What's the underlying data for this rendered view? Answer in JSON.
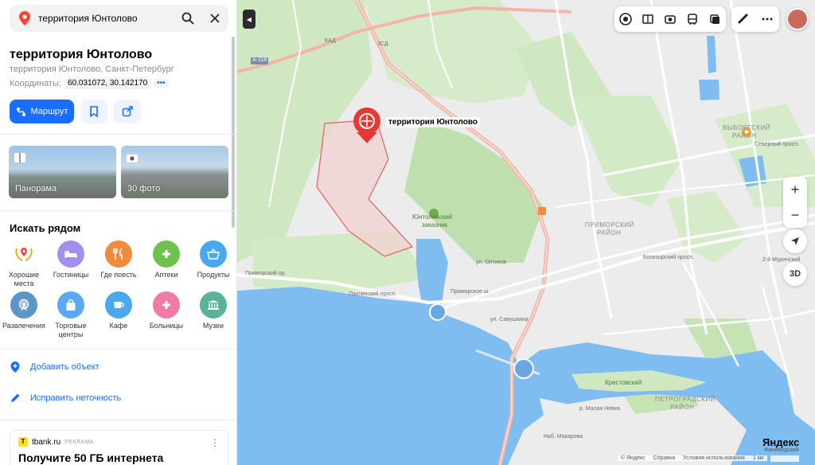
{
  "search": {
    "query": "территория Юнтолово"
  },
  "place": {
    "title": "территория Юнтолово",
    "subtitle": "территория Юнтолово, Санкт-Петербург",
    "coords_label": "Координаты:",
    "coords_value": "60.031072, 30.142170",
    "coords_more": "•••"
  },
  "actions": {
    "route_label": "Маршрут"
  },
  "photos": [
    {
      "label": "Панорама"
    },
    {
      "label": "30 фото"
    }
  ],
  "nearby": {
    "heading": "Искать рядом",
    "categories": [
      {
        "label": "Хорошие места",
        "icon": "laurel-pin-icon",
        "color": "#f5a623"
      },
      {
        "label": "Гостиницы",
        "icon": "bed-icon",
        "color": "#a38ff0"
      },
      {
        "label": "Где поесть",
        "icon": "fork-knife-icon",
        "color": "#f28a3c"
      },
      {
        "label": "Аптеки",
        "icon": "plus-icon",
        "color": "#6cc24a"
      },
      {
        "label": "Продукты",
        "icon": "basket-icon",
        "color": "#4aa8f0"
      },
      {
        "label": "Развлечения",
        "icon": "ferris-wheel-icon",
        "color": "#5b96c9"
      },
      {
        "label": "Торговые центры",
        "icon": "bag-icon",
        "color": "#5aa9f2"
      },
      {
        "label": "Кафе",
        "icon": "cup-icon",
        "color": "#4aa8f0"
      },
      {
        "label": "Больницы",
        "icon": "plus-icon",
        "color": "#f07aa8"
      },
      {
        "label": "Музеи",
        "icon": "museum-icon",
        "color": "#5bb29b"
      }
    ]
  },
  "links": {
    "add_object": "Добавить объект",
    "fix_error": "Исправить неточность"
  },
  "ad": {
    "source": "tbank.ru",
    "tag": "РЕКЛАМА",
    "headline": "Получите 50 ГБ интернета"
  },
  "map": {
    "marker_label": "территория Юнтолово",
    "reserve_label_1": "Юнтоловский",
    "reserve_label_2": "заказник",
    "district_1a": "ВЫБОРГСКИЙ",
    "district_1b": "РАЙОН",
    "district_2a": "ПРИМОРСКИЙ",
    "district_2b": "РАЙОН",
    "district_3a": "ПЕТРОГРАДСКИЙ",
    "district_3b": "РАЙОН",
    "island": "Крестовский",
    "road_kad": "КАД",
    "road_a118": "А-118",
    "road_zsd": "ЗСД",
    "street_primorsky": "Приморский пр.",
    "street_primorskoe": "Приморское ш.",
    "street_pakhtinsky": "Пахтинский просп.",
    "street_optikov": "ул. Оптиков",
    "street_bogatyrsky": "Богатырский просп.",
    "street_savushkina": "ул. Савушкина",
    "street_severny": "Северный просп.",
    "street_murinsky": "2-й Муринский",
    "street_makarova": "Наб. Макарова",
    "street_malaya_nevka": "р. Малая Невка",
    "zoom_in": "+",
    "zoom_out": "−",
    "btn_3d": "3D",
    "copyright": "© Яндекс",
    "help": "Справка",
    "terms": "Условия использования",
    "scale": "1 км",
    "brand": "Яндекс",
    "brand_sub": "Финляндский"
  }
}
